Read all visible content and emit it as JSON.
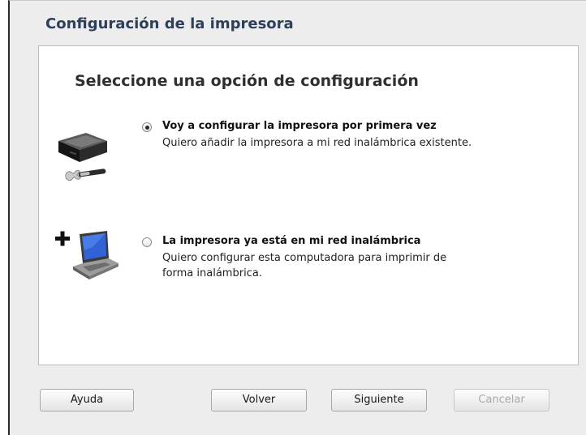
{
  "window": {
    "title": "Configuración de la impresora"
  },
  "panel": {
    "heading": "Seleccione una opción de configuración"
  },
  "options": [
    {
      "title": "Voy a configurar la impresora por primera vez",
      "description": "Quiero añadir la impresora a mi red inalámbrica existente.",
      "selected": true,
      "icon": "printer-wrench-icon"
    },
    {
      "title": "La impresora ya está en mi red inalámbrica",
      "description_line1": "Quiero configurar esta computadora para imprimir de",
      "description_line2": "forma inalámbrica.",
      "selected": false,
      "icon": "add-laptop-icon"
    }
  ],
  "buttons": {
    "help": "Ayuda",
    "back": "Volver",
    "next": "Siguiente",
    "cancel": "Cancelar"
  },
  "colors": {
    "title": "#2e3f5a",
    "disabled_text": "#a9a9a9"
  }
}
